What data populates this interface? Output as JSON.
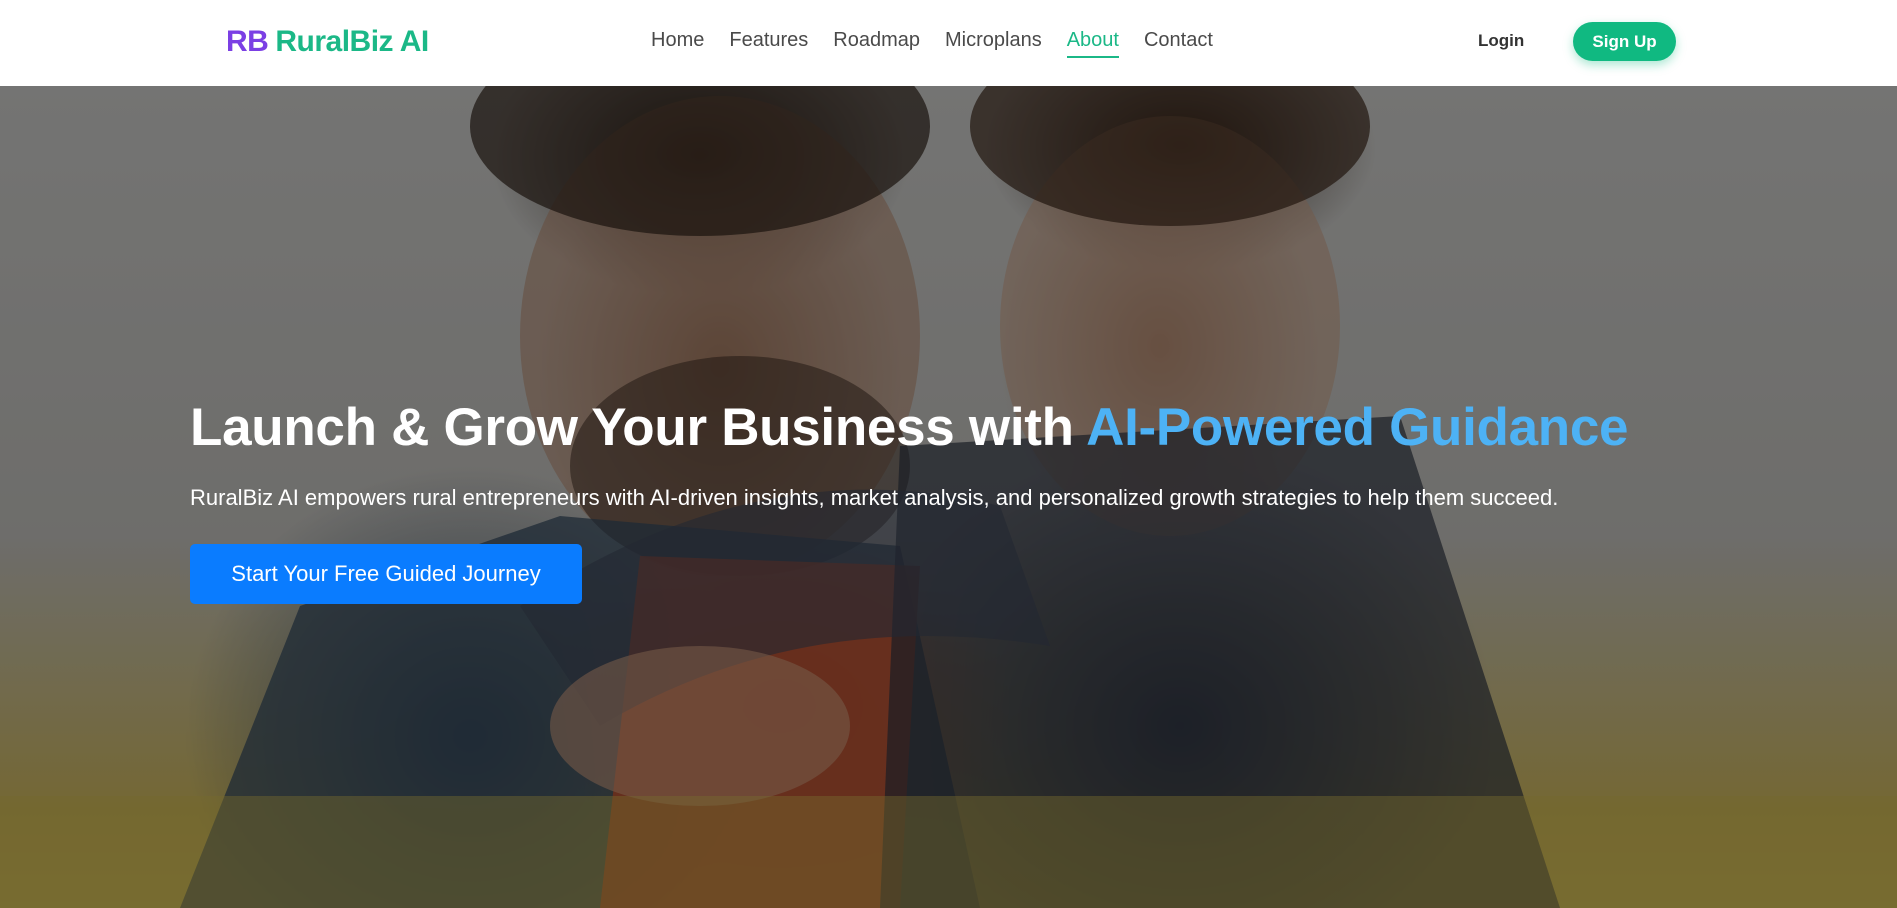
{
  "brand": {
    "initials": "RB",
    "name": "RuralBiz AI",
    "initials_color": "#7b3fe4",
    "name_color": "#1bb887"
  },
  "nav": {
    "items": [
      {
        "label": "Home",
        "active": false
      },
      {
        "label": "Features",
        "active": false
      },
      {
        "label": "Roadmap",
        "active": false
      },
      {
        "label": "Microplans",
        "active": false
      },
      {
        "label": "About",
        "active": true
      },
      {
        "label": "Contact",
        "active": false
      }
    ],
    "login_label": "Login",
    "signup_label": "Sign Up"
  },
  "hero": {
    "title_main": "Launch & Grow Your Business with ",
    "title_accent": "AI-Powered Guidance",
    "subtitle": "RuralBiz AI empowers rural entrepreneurs with AI-driven insights, market analysis, and personalized growth strategies to help them succeed.",
    "cta_label": "Start Your Free Guided Journey",
    "accent_color": "#4db2f5",
    "cta_color": "#0a7cff"
  },
  "colors": {
    "primary_green": "#10b981",
    "text_dark": "#4a4a4a"
  }
}
